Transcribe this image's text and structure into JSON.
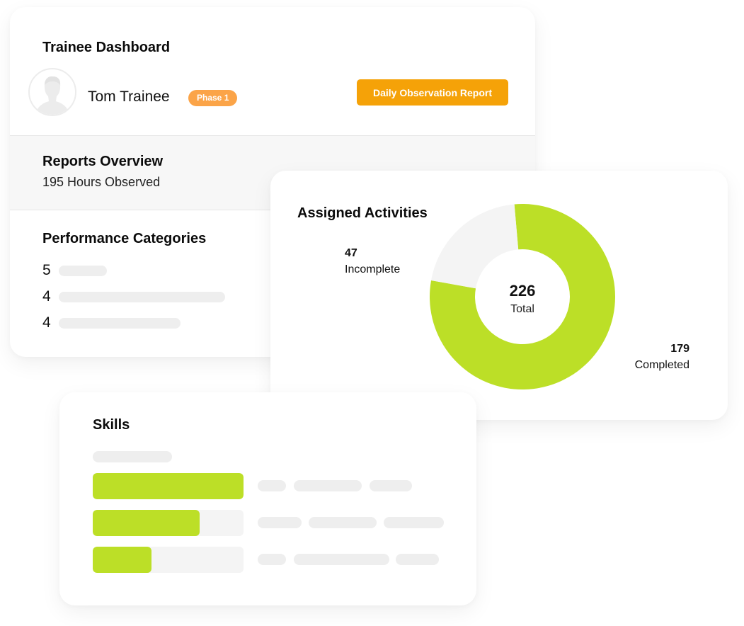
{
  "dashboard": {
    "title": "Trainee Dashboard",
    "user": {
      "name": "Tom Trainee",
      "phase_badge": "Phase 1",
      "avatar_icon": "user-avatar-icon"
    },
    "report_button": "Daily Observation Report",
    "colors": {
      "button": "#f5a208",
      "badge": "#fba448"
    }
  },
  "reports_overview": {
    "title": "Reports Overview",
    "subtitle": "195 Hours Observed"
  },
  "performance_categories": {
    "title": "Performance Categories",
    "rows": [
      {
        "score": "5"
      },
      {
        "score": "4"
      },
      {
        "score": "4"
      }
    ]
  },
  "assigned_activities": {
    "title": "Assigned Activities",
    "total": {
      "value": "226",
      "label": "Total"
    },
    "incomplete": {
      "value": "47",
      "label": "Incomplete"
    },
    "completed": {
      "value": "179",
      "label": "Completed"
    }
  },
  "skills": {
    "title": "Skills",
    "bars": [
      {
        "progress": 1.0
      },
      {
        "progress": 0.71
      },
      {
        "progress": 0.39
      }
    ],
    "accent_color": "#bcdf27"
  },
  "chart_data": {
    "type": "pie",
    "title": "Assigned Activities",
    "labels": [
      "Completed",
      "Incomplete"
    ],
    "values": [
      179,
      47
    ],
    "colors": [
      "#bcdf27",
      "#f4f4f4"
    ],
    "center_label": {
      "value": 226,
      "text": "Total"
    },
    "donut": true
  }
}
